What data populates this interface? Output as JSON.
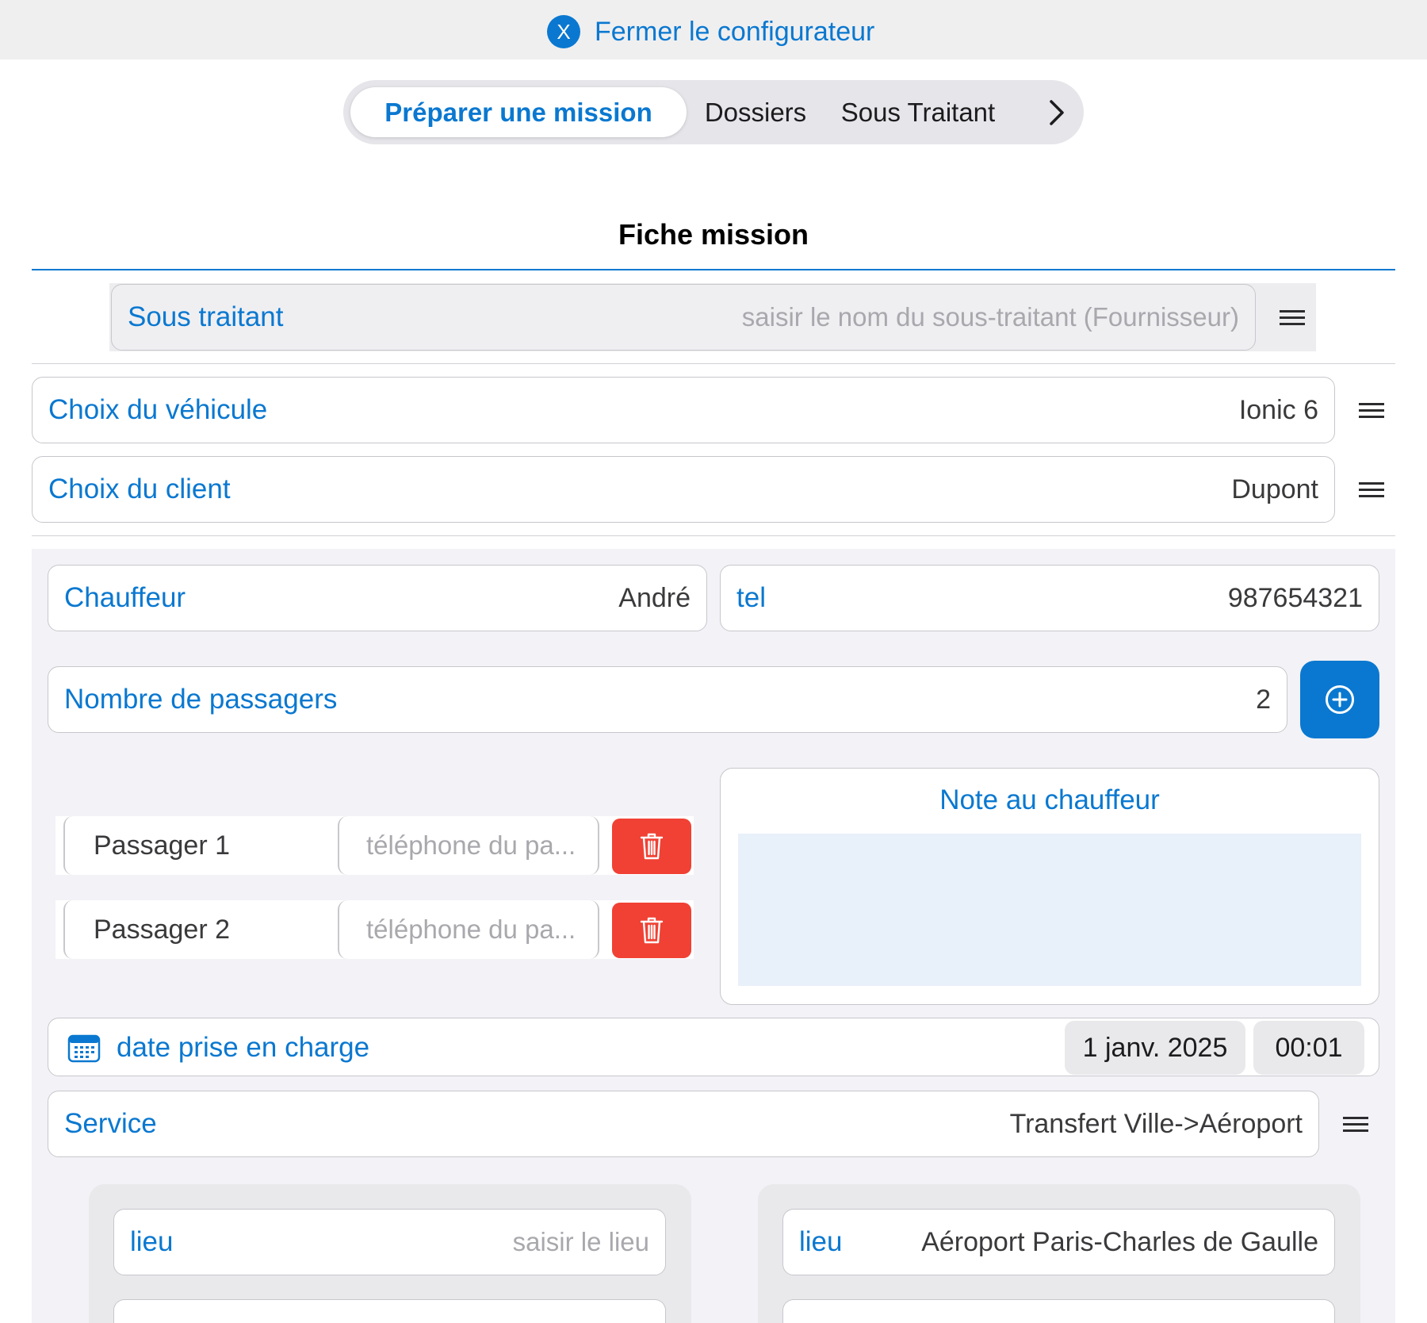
{
  "topbar": {
    "close_icon_label": "X",
    "close_label": "Fermer le configurateur"
  },
  "tabs": [
    {
      "label": "Préparer une mission",
      "active": true
    },
    {
      "label": "Dossiers"
    },
    {
      "label": "Sous Traitant"
    }
  ],
  "tabs_more_icon": "chevron-right-icon",
  "title": "Fiche mission",
  "sous_traitant": {
    "label": "Sous traitant",
    "placeholder": "saisir le nom du sous-traitant (Fournisseur)"
  },
  "vehicule": {
    "label": "Choix du véhicule",
    "value": "Ionic 6"
  },
  "client": {
    "label": "Choix du client",
    "value": "Dupont"
  },
  "chauffeur": {
    "label": "Chauffeur",
    "value": "André"
  },
  "tel": {
    "label": "tel",
    "value": "987654321"
  },
  "passagers": {
    "label": "Nombre de passagers",
    "value": "2"
  },
  "passenger_list": [
    {
      "name": "Passager 1",
      "phone_placeholder": "téléphone du pa..."
    },
    {
      "name": "Passager 2",
      "phone_placeholder": "téléphone du pa..."
    }
  ],
  "note": {
    "title": "Note au chauffeur",
    "value": ""
  },
  "date": {
    "label": "date prise en charge",
    "date": "1 janv. 2025",
    "time": "00:01"
  },
  "service": {
    "label": "Service",
    "value": "Transfert Ville->Aéroport"
  },
  "depart": {
    "label": "lieu",
    "placeholder": "saisir le lieu"
  },
  "arrivee": {
    "label": "lieu",
    "value": "Aéroport Paris-Charles de Gaulle"
  },
  "colors": {
    "accent": "#0a78d0",
    "danger": "#f04134",
    "panel": "#f2f2f7"
  }
}
